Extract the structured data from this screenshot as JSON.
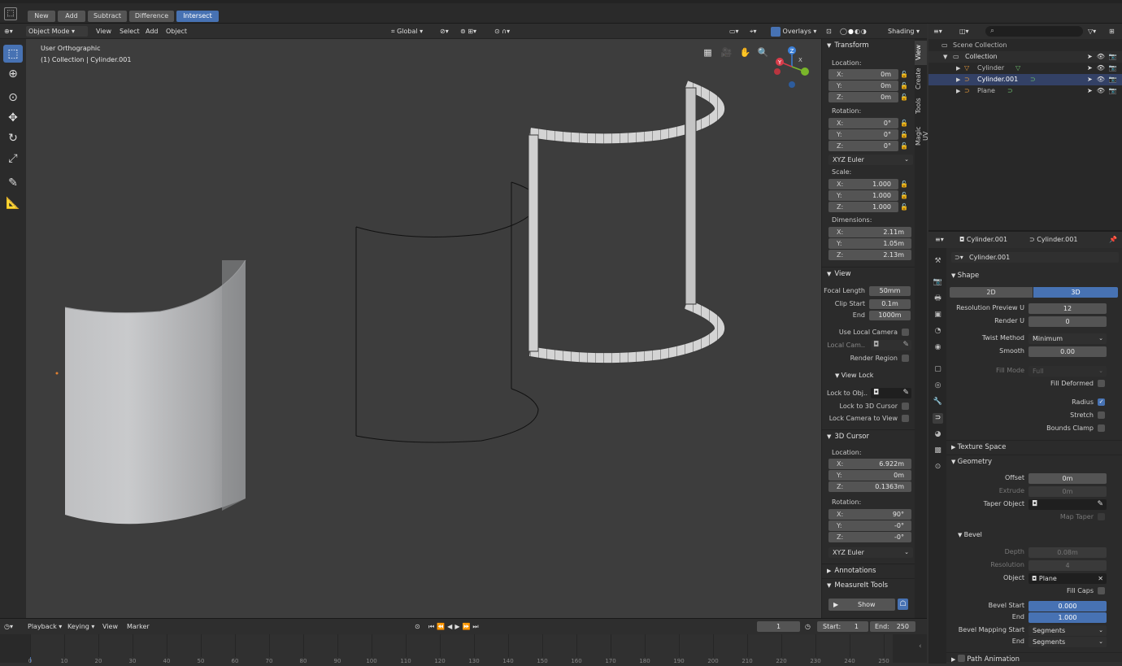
{
  "topbar": {
    "buttons": [
      "New",
      "Add",
      "Subtract",
      "Difference",
      "Intersect"
    ],
    "active": "Intersect"
  },
  "viewport_header": {
    "mode": "Object Mode",
    "menus": [
      "View",
      "Select",
      "Add",
      "Object"
    ],
    "transform_orientation": "Global",
    "overlays": "Overlays",
    "shading": "Shading"
  },
  "viewport": {
    "view_name": "User Orthographic",
    "collection_info": "(1) Collection | Cylinder.001",
    "gizmo_axes": [
      "X",
      "Y",
      "Z"
    ]
  },
  "npanel": {
    "tabs": [
      "View",
      "Create",
      "Tools",
      "Magic UV"
    ],
    "transform": {
      "title": "Transform",
      "location_label": "Location:",
      "location": [
        {
          "k": "X:",
          "v": "0m"
        },
        {
          "k": "Y:",
          "v": "0m"
        },
        {
          "k": "Z:",
          "v": "0m"
        }
      ],
      "rotation_label": "Rotation:",
      "rotation": [
        {
          "k": "X:",
          "v": "0°"
        },
        {
          "k": "Y:",
          "v": "0°"
        },
        {
          "k": "Z:",
          "v": "0°"
        }
      ],
      "rotation_mode": "XYZ Euler",
      "scale_label": "Scale:",
      "scale": [
        {
          "k": "X:",
          "v": "1.000"
        },
        {
          "k": "Y:",
          "v": "1.000"
        },
        {
          "k": "Z:",
          "v": "1.000"
        }
      ],
      "dimensions_label": "Dimensions:",
      "dimensions": [
        {
          "k": "X:",
          "v": "2.11m"
        },
        {
          "k": "Y:",
          "v": "1.05m"
        },
        {
          "k": "Z:",
          "v": "2.13m"
        }
      ]
    },
    "view": {
      "title": "View",
      "focal_length_label": "Focal Length",
      "focal_length": "50mm",
      "clip_start_label": "Clip Start",
      "clip_start": "0.1m",
      "end_label": "End",
      "clip_end": "1000m",
      "use_local_camera": "Use Local Camera",
      "local_camera": "Local Cam..",
      "render_region": "Render Region",
      "view_lock": "View Lock",
      "lock_to_obj": "Lock to Obj..",
      "lock_to_cursor": "Lock to 3D Cursor",
      "lock_camera": "Lock Camera to View"
    },
    "cursor": {
      "title": "3D Cursor",
      "location_label": "Location:",
      "location": [
        {
          "k": "X:",
          "v": "6.922m"
        },
        {
          "k": "Y:",
          "v": "0m"
        },
        {
          "k": "Z:",
          "v": "0.1363m"
        }
      ],
      "rotation_label": "Rotation:",
      "rotation": [
        {
          "k": "X:",
          "v": "90°"
        },
        {
          "k": "Y:",
          "v": "-0°"
        },
        {
          "k": "Z:",
          "v": "-0°"
        }
      ],
      "rotation_mode": "XYZ Euler"
    },
    "annotations": "Annotations",
    "measureit": "MeasureIt Tools",
    "show": "Show"
  },
  "outliner": {
    "scene_collection": "Scene Collection",
    "collection": "Collection",
    "items": [
      "Cylinder",
      "Cylinder.001",
      "Plane"
    ]
  },
  "properties": {
    "header_object": "Cylinder.001",
    "header_data": "Cylinder.001",
    "data_name": "Cylinder.001",
    "shape": {
      "title": "Shape",
      "mode_2d": "2D",
      "mode_3d": "3D",
      "res_preview_label": "Resolution Preview U",
      "res_preview": "12",
      "render_u_label": "Render U",
      "render_u": "0",
      "twist_method_label": "Twist Method",
      "twist_method": "Minimum",
      "smooth_label": "Smooth",
      "smooth": "0.00",
      "fill_mode_label": "Fill Mode",
      "fill_mode": "Full",
      "fill_deformed": "Fill Deformed",
      "radius": "Radius",
      "stretch": "Stretch",
      "bounds_clamp": "Bounds Clamp"
    },
    "texture_space": "Texture Space",
    "geometry": {
      "title": "Geometry",
      "offset_label": "Offset",
      "offset": "0m",
      "extrude_label": "Extrude",
      "extrude": "0m",
      "taper_label": "Taper Object",
      "map_taper": "Map Taper"
    },
    "bevel": {
      "title": "Bevel",
      "depth_label": "Depth",
      "depth": "0.08m",
      "resolution_label": "Resolution",
      "resolution": "4",
      "object_label": "Object",
      "object": "Plane",
      "fill_caps": "Fill Caps",
      "bevel_start_label": "Bevel Start",
      "bevel_start": "0.000",
      "end_label": "End",
      "bevel_end": "1.000",
      "mapping_start_label": "Bevel Mapping Start",
      "mapping_start": "Segments",
      "mapping_end_label": "End",
      "mapping_end": "Segments"
    },
    "path_animation": "Path Animation"
  },
  "timeline": {
    "menus": [
      "Playback",
      "Keying",
      "View",
      "Marker"
    ],
    "current_frame": "1",
    "start": "Start:",
    "start_value": "1",
    "end": "End:",
    "end_value": "250",
    "ticks": [
      "0",
      "10",
      "20",
      "30",
      "40",
      "50",
      "60",
      "70",
      "80",
      "90",
      "100",
      "110",
      "120",
      "130",
      "140",
      "150",
      "160",
      "170",
      "180",
      "190",
      "200",
      "210",
      "220",
      "230",
      "240",
      "250"
    ]
  }
}
